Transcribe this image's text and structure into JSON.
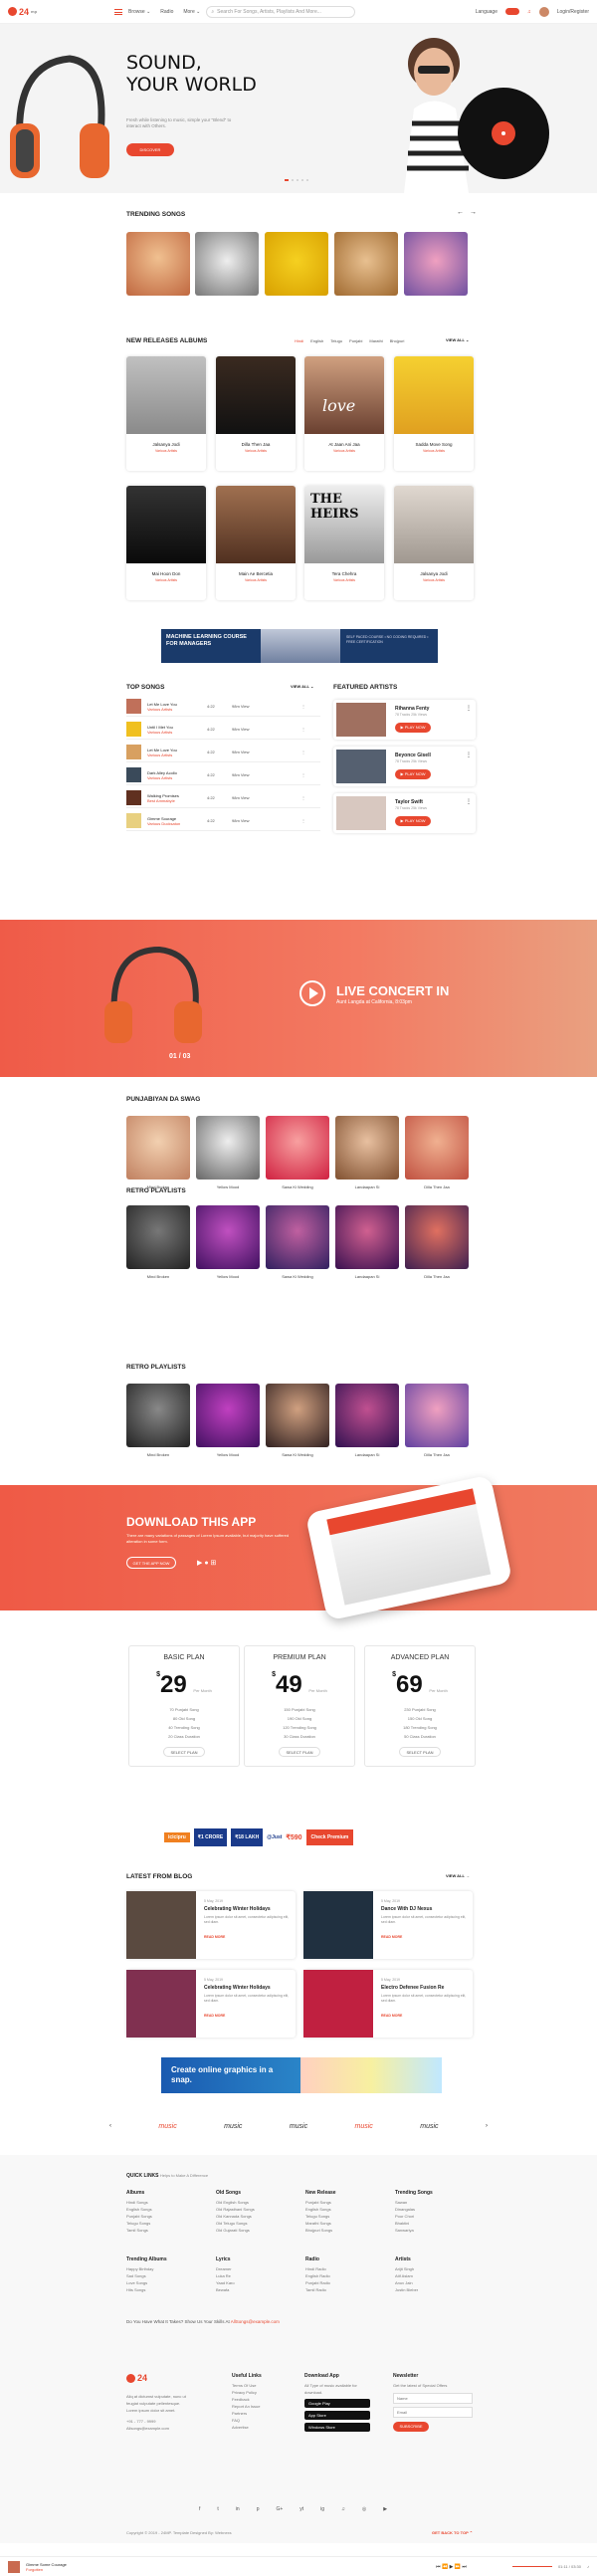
{
  "header": {
    "logo_text": "24",
    "logo_suffix": "mp",
    "nav": [
      "Browse ⌄",
      "Radio",
      "More ⌄"
    ],
    "search_placeholder": "Search For Songs, Artists, Playlists And More...",
    "language_label": "Language",
    "user_label": "Login/Register"
  },
  "hero": {
    "title_line1": "SOUND,",
    "title_line2": "YOUR WORLD",
    "text": "Fresh while listening to music, simple your \"Blend\" to interact with Others.",
    "button": "DISCOVER"
  },
  "trending": {
    "title": "TRENDING SONGS",
    "arrows": "← →"
  },
  "new_releases": {
    "title": "NEW RELEASES ALBUMS",
    "filters": [
      "Hindi",
      "English",
      "Telugu",
      "Punjabi",
      "Marathi",
      "Bhojpuri"
    ],
    "view_all": "VIEW ALL ⌄",
    "albums": [
      {
        "title": "Jalsanya Jodi",
        "sub": "Various Artists"
      },
      {
        "title": "Dilla Then Jaa",
        "sub": "Various Artists"
      },
      {
        "title": "At Jaan Ani Jaa",
        "sub": "Various Artists"
      },
      {
        "title": "Sadda Move Song",
        "sub": "Various Artists"
      },
      {
        "title": "Mai Hoon Don",
        "sub": "Various Artists"
      },
      {
        "title": "Main Ae Bercetia",
        "sub": "Various Artists"
      },
      {
        "title": "Tera Chehra",
        "sub": "Various Artists"
      },
      {
        "title": "Jalsanya Jodi",
        "sub": "Various Artists"
      }
    ],
    "heirs_text": "THE HEIRS",
    "love_text": "love"
  },
  "ad_banner": {
    "left": "MACHINE LEARNING COURSE FOR MANAGERS",
    "right": "SELF PACED COURSE • NO CODING REQUIRED • FREE CERTIFICATION"
  },
  "top_songs": {
    "title": "TOP SONGS",
    "view_all": "VIEW ALL ⌄",
    "songs": [
      {
        "title": "Let Me Love You",
        "artist": "Various Artists",
        "time": "4:22",
        "views": "98m View"
      },
      {
        "title": "Until I Met You",
        "artist": "Various Artists",
        "time": "4:22",
        "views": "98m View"
      },
      {
        "title": "Let Me Love You",
        "artist": "Various Artists",
        "time": "4:22",
        "views": "98m View"
      },
      {
        "title": "Dark Alley Acollo",
        "artist": "Various Artists",
        "time": "4:22",
        "views": "98m View"
      },
      {
        "title": "Walking Promises",
        "artist": "Best Ammabyle",
        "time": "4:22",
        "views": "98m View"
      },
      {
        "title": "Gimme Sourage",
        "artist": "Various Ducksaton",
        "time": "4:22",
        "views": "98m View"
      }
    ]
  },
  "featured_artists": {
    "title": "FEATURED ARTISTS",
    "play_label": "▶ PLAY NOW",
    "artists": [
      {
        "name": "Rihanna Fenty",
        "meta": "78 Tracks   25k Views"
      },
      {
        "name": "Beyonce Gisell",
        "meta": "78 Tracks   25k Views"
      },
      {
        "name": "Taylor Swift",
        "meta": "78 Tracks   25k Views"
      }
    ]
  },
  "concert": {
    "title": "LIVE CONCERT IN",
    "subtitle": "Aunt Langda at California, 8:03pm",
    "pager": "01 / 03"
  },
  "punjabiyan": {
    "title": "PUNJABIYAN DA SWAG",
    "items": [
      "Mind Broken",
      "Yellow Mood",
      "Sawa Ki Wedding",
      "Landaapan Si",
      "Dilla Then Jaa"
    ]
  },
  "retro1": {
    "title": "RETRO PLAYLISTS",
    "items": [
      "Mind Broken",
      "Yellow Mood",
      "Sawa Ki Wedding",
      "Landaapan Si",
      "Dilla Then Jaa"
    ]
  },
  "retro2": {
    "title": "RETRO PLAYLISTS",
    "items": [
      "Mind Broken",
      "Yellow Mood",
      "Sawa Ki Wedding",
      "Landaapan Si",
      "Dilla Then Jaa"
    ]
  },
  "download": {
    "title": "DOWNLOAD THIS APP",
    "text": "There are many variations of passages of Lorem Ipsum available, but majority have suffered alteration in some form.",
    "button": "GET THE APP NOW"
  },
  "plans": [
    {
      "name": "BASIC PLAN",
      "currency": "$",
      "price": "29",
      "per": "Per Month",
      "features": [
        "70 Punjabi Song",
        "80 Old Song",
        "40 Trending Song",
        "20 Class Duration"
      ],
      "button": "SELECT PLAN"
    },
    {
      "name": "PREMIUM PLAN",
      "currency": "$",
      "price": "49",
      "per": "Per Month",
      "features": [
        "150 Punjabi Song",
        "190 Old Song",
        "120 Trending Song",
        "30 Class Duration"
      ],
      "button": "SELECT PLAN"
    },
    {
      "name": "ADVANCED PLAN",
      "currency": "$",
      "price": "69",
      "per": "Per Month",
      "features": [
        "230 Punjabi Song",
        "150 Old Song",
        "180 Trending Song",
        "50 Class Duration"
      ],
      "button": "SELECT PLAN"
    }
  ],
  "insurance_ad": {
    "brand": "icicipru",
    "crore": "₹1 CRORE",
    "lakh": "₹18 LAKH",
    "just": "@Just",
    "price": "₹590",
    "cta": "Check Premium"
  },
  "blog": {
    "title": "LATEST FROM BLOG",
    "view_all": "VIEW ALL →",
    "posts": [
      {
        "date": "5 May, 2019",
        "title": "Celebrating Winter Holidays",
        "text": "Lorem ipsum dolor sit amet, consectetur adipiscing elit, sed diam.",
        "more": "READ MORE"
      },
      {
        "date": "5 May, 2019",
        "title": "Dance With DJ Nexus",
        "text": "Lorem ipsum dolor sit amet, consectetur adipiscing elit, sed diam.",
        "more": "READ MORE"
      },
      {
        "date": "5 May, 2019",
        "title": "Celebrating Winter Holidays",
        "text": "Lorem ipsum dolor sit amet, consectetur adipiscing elit, sed diam.",
        "more": "READ MORE"
      },
      {
        "date": "5 May, 2019",
        "title": "Electro Defenee Fusion Re",
        "text": "Lorem ipsum dolor sit amet, consectetur adipiscing elit, sed diam.",
        "more": "READ MORE"
      }
    ]
  },
  "canva_ad": {
    "text": "Create online graphics in a snap."
  },
  "partners": [
    "music",
    "music",
    "music",
    "music",
    "music"
  ],
  "quick_links": {
    "title": "QUICK LINKS",
    "subtitle": "Helps to Make A Difference",
    "columns": [
      {
        "head": "Albums",
        "items": [
          "Hindi Songs",
          "English Songs",
          "Punjabi Songs",
          "Telugu Songs",
          "Tamil Songs"
        ]
      },
      {
        "head": "Old Songs",
        "items": [
          "Old English Songs",
          "Old Rajasthani Songs",
          "Old Kannada Songs",
          "Old Telugu Songs",
          "Old Gujarati Songs"
        ]
      },
      {
        "head": "New Release",
        "items": [
          "Punjabi Songs",
          "English Songs",
          "Telugu Songs",
          "Marathi Songs",
          "Bhojpuri Songs"
        ]
      },
      {
        "head": "Trending Songs",
        "items": [
          "Sawan",
          "Dinangalas",
          "Poor Chori",
          "Bhaktini",
          "Sanwariya"
        ]
      },
      {
        "head": "Trending Albums",
        "items": [
          "Happy Birthday",
          "Sad Songs",
          "Love Songs",
          "Hits Songs"
        ]
      },
      {
        "head": "Lyrics",
        "items": [
          "Dreamer",
          "Luka Re",
          "Yaad Karo",
          "Bewafa"
        ]
      },
      {
        "head": "Radio",
        "items": [
          "Hindi Radio",
          "English Radio",
          "Punjabi Radio",
          "Tamil Radio"
        ]
      },
      {
        "head": "Artists",
        "items": [
          "Arijit Singh",
          "Atif Aslam",
          "Anuv Jain",
          "Justin Bieber"
        ]
      }
    ],
    "question": "Do You Have What It Takes? Show Us Your Skills At",
    "email": "AllSongs@example.com"
  },
  "footer": {
    "about": "Aliq at dictumst vulputate, nunc ut feugiat vulputate pellentesque. Lorem ipsum dolor sit amet.",
    "phone": "+91 - 777 - 9999",
    "email": "Allsongs@example.com",
    "useful_head": "Useful Links",
    "useful": [
      "Terms Of Use",
      "Privacy Policy",
      "Feedback",
      "Report An Issue",
      "Partners",
      "FAQ",
      "Advertise"
    ],
    "app_head": "Download App",
    "app_text": "All Type of music available for download.",
    "stores": [
      "Google Play",
      "App Store",
      "Windows Store"
    ],
    "news_head": "Newsletter",
    "news_text": "Get the latest of Special Offers",
    "name_placeholder": "Name",
    "email_placeholder": "Email",
    "subscribe": "SUBSCRIBE",
    "copyright": "Copyright © 2019 - 24MP. Template Designed By: Webnexs",
    "go_top": "GET BACK TO TOP ⌃"
  },
  "socials": [
    "f",
    "t",
    "in",
    "p",
    "G+",
    "yt",
    "ig",
    "♫",
    "◎",
    "▶"
  ],
  "player": {
    "track": "Gimme Some Courage",
    "artist": "Forgotten",
    "controls": "⏮ ⏪ ▶ ⏩ ⏭",
    "time": "01:11 / 03:30"
  },
  "colors": {
    "accent": "#e8472f",
    "accent2": "#f08a70"
  }
}
